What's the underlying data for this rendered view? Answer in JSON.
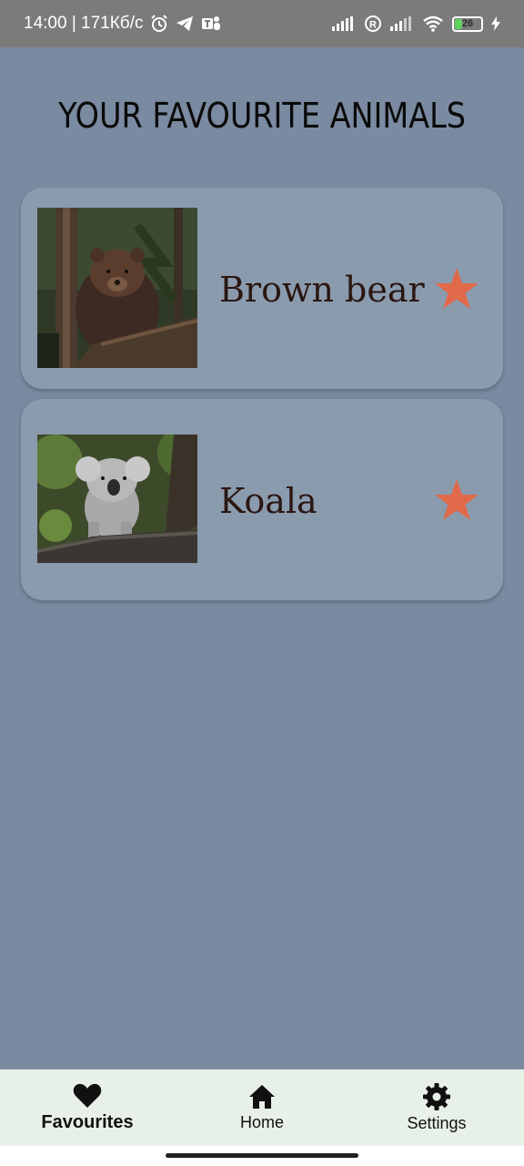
{
  "status_bar": {
    "time_speed": "14:00 | 171Кб/с",
    "battery": "26",
    "icons": [
      "alarm-icon",
      "telegram-icon",
      "teams-icon",
      "signal-icon",
      "roaming-icon",
      "signal-icon",
      "wifi-icon",
      "battery-icon",
      "charging-icon"
    ]
  },
  "page": {
    "title": "YOUR FAVOURITE ANIMALS"
  },
  "favourites": [
    {
      "name": "Brown bear",
      "image": "brown-bear-photo",
      "favourite": true
    },
    {
      "name": "Koala",
      "image": "koala-photo",
      "favourite": true
    }
  ],
  "bottom_nav": {
    "items": [
      {
        "label": "Favourites",
        "icon": "heart-icon",
        "active": true
      },
      {
        "label": "Home",
        "icon": "home-icon",
        "active": false
      },
      {
        "label": "Settings",
        "icon": "gear-icon",
        "active": false
      }
    ]
  },
  "colors": {
    "background": "#7a8aa1",
    "card": "#8b9bae",
    "star": "#e06a4a",
    "nav_background": "#e8f1e7"
  }
}
